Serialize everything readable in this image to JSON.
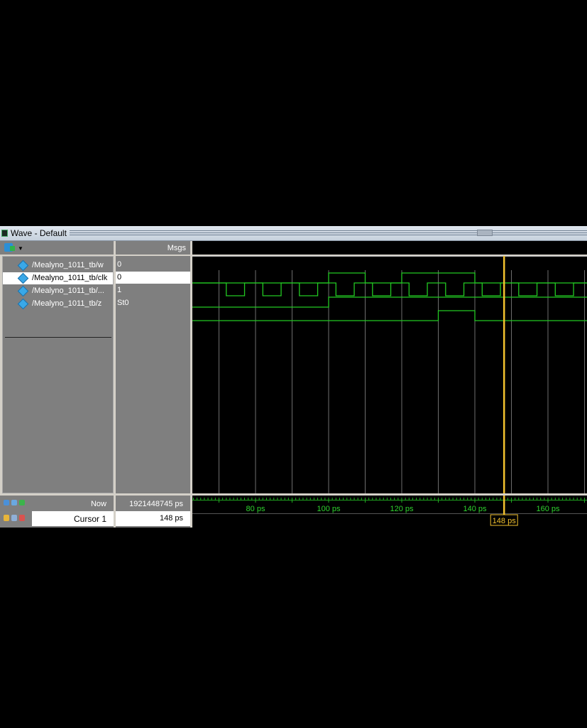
{
  "window": {
    "title": "Wave - Default"
  },
  "columns": {
    "msgs_label": "Msgs"
  },
  "signals": [
    {
      "name": "/Mealyno_1011_tb/w",
      "value": "0",
      "selected": false
    },
    {
      "name": "/Mealyno_1011_tb/clk",
      "value": "0",
      "selected": true
    },
    {
      "name": "/Mealyno_1011_tb/...",
      "value": "1",
      "selected": false
    },
    {
      "name": "/Mealyno_1011_tb/z",
      "value": "St0",
      "selected": false
    }
  ],
  "status": {
    "now_label": "Now",
    "now_value": "1921448745 ps",
    "cursor_label": "Cursor 1",
    "cursor_value": "148 ps",
    "cursor_tag": "148 ps"
  },
  "timeline": {
    "ticks": [
      {
        "t": 80,
        "label": "80 ps"
      },
      {
        "t": 100,
        "label": "100 ps"
      },
      {
        "t": 120,
        "label": "120 ps"
      },
      {
        "t": 140,
        "label": "140 ps"
      },
      {
        "t": 160,
        "label": "160 ps"
      }
    ],
    "cursor_time": 148
  },
  "colors": {
    "wave": "#22c922",
    "cursor": "#f2c12e",
    "grid": "#6e6e6e"
  },
  "icons": [
    "wave-window-icon",
    "add-wave-icon",
    "signal-icon",
    "lock-icon",
    "cursor-add-icon"
  ]
}
